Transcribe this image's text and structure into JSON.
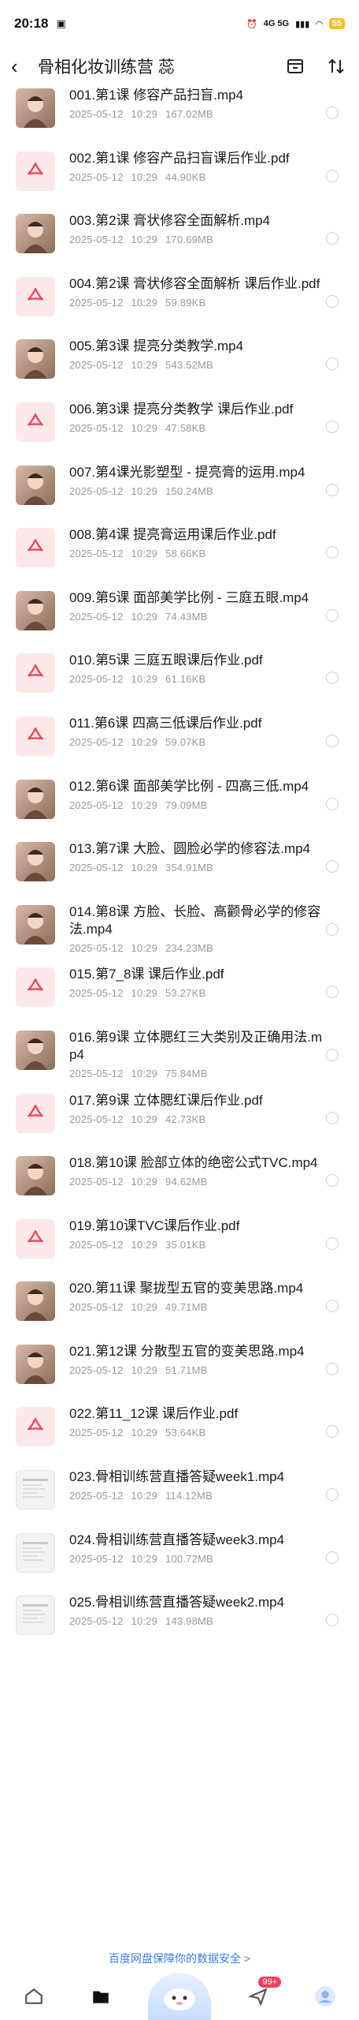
{
  "status": {
    "time": "20:18",
    "network": "4G 5G",
    "battery": "55"
  },
  "header": {
    "title": "骨相化妆训练营 蕊"
  },
  "files": [
    {
      "name": "001.第1课 修容产品扫盲.mp4",
      "date": "2025-05-12",
      "time": "10:29",
      "size": "167.02MB",
      "type": "video"
    },
    {
      "name": "002.第1课 修容产品扫盲课后作业.pdf",
      "date": "2025-05-12",
      "time": "10:29",
      "size": "44.90KB",
      "type": "pdf"
    },
    {
      "name": "003.第2课 膏状修容全面解析.mp4",
      "date": "2025-05-12",
      "time": "10:29",
      "size": "170.69MB",
      "type": "video"
    },
    {
      "name": "004.第2课 膏状修容全面解析 课后作业.pdf",
      "date": "2025-05-12",
      "time": "10:29",
      "size": "59.89KB",
      "type": "pdf"
    },
    {
      "name": "005.第3课 提亮分类教学.mp4",
      "date": "2025-05-12",
      "time": "10:29",
      "size": "543.52MB",
      "type": "video"
    },
    {
      "name": "006.第3课 提亮分类教学 课后作业.pdf",
      "date": "2025-05-12",
      "time": "10:29",
      "size": "47.58KB",
      "type": "pdf"
    },
    {
      "name": "007.第4课光影塑型 - 提亮膏的运用.mp4",
      "date": "2025-05-12",
      "time": "10:29",
      "size": "150.24MB",
      "type": "video"
    },
    {
      "name": "008.第4课 提亮膏运用课后作业.pdf",
      "date": "2025-05-12",
      "time": "10:29",
      "size": "58.66KB",
      "type": "pdf"
    },
    {
      "name": "009.第5课 面部美学比例 - 三庭五眼.mp4",
      "date": "2025-05-12",
      "time": "10:29",
      "size": "74.43MB",
      "type": "video"
    },
    {
      "name": "010.第5课 三庭五眼课后作业.pdf",
      "date": "2025-05-12",
      "time": "10:29",
      "size": "61.16KB",
      "type": "pdf"
    },
    {
      "name": "011.第6课 四高三低课后作业.pdf",
      "date": "2025-05-12",
      "time": "10:29",
      "size": "59.07KB",
      "type": "pdf"
    },
    {
      "name": "012.第6课 面部美学比例 - 四高三低.mp4",
      "date": "2025-05-12",
      "time": "10:29",
      "size": "79.09MB",
      "type": "video"
    },
    {
      "name": "013.第7课 大脸、圆脸必学的修容法.mp4",
      "date": "2025-05-12",
      "time": "10:29",
      "size": "354.91MB",
      "type": "video"
    },
    {
      "name": "014.第8课 方脸、长脸、高颧骨必学的修容法.mp4",
      "date": "2025-05-12",
      "time": "10:29",
      "size": "234.23MB",
      "type": "video"
    },
    {
      "name": "015.第7_8课 课后作业.pdf",
      "date": "2025-05-12",
      "time": "10:29",
      "size": "53.27KB",
      "type": "pdf"
    },
    {
      "name": "016.第9课 立体腮红三大类别及正确用法.mp4",
      "date": "2025-05-12",
      "time": "10:29",
      "size": "75.84MB",
      "type": "video"
    },
    {
      "name": "017.第9课 立体腮红课后作业.pdf",
      "date": "2025-05-12",
      "time": "10:29",
      "size": "42.73KB",
      "type": "pdf"
    },
    {
      "name": "018.第10课 脸部立体的绝密公式TVC.mp4",
      "date": "2025-05-12",
      "time": "10:29",
      "size": "94.62MB",
      "type": "video"
    },
    {
      "name": "019.第10课TVC课后作业.pdf",
      "date": "2025-05-12",
      "time": "10:29",
      "size": "35.01KB",
      "type": "pdf"
    },
    {
      "name": "020.第11课 聚拢型五官的变美思路.mp4",
      "date": "2025-05-12",
      "time": "10:29",
      "size": "49.71MB",
      "type": "video"
    },
    {
      "name": "021.第12课 分散型五官的变美思路.mp4",
      "date": "2025-05-12",
      "time": "10:29",
      "size": "51.71MB",
      "type": "video"
    },
    {
      "name": "022.第11_12课 课后作业.pdf",
      "date": "2025-05-12",
      "time": "10:29",
      "size": "53.64KB",
      "type": "pdf"
    },
    {
      "name": "023.骨相训练营直播答疑week1.mp4",
      "date": "2025-05-12",
      "time": "10:29",
      "size": "114.12MB",
      "type": "doc"
    },
    {
      "name": "024.骨相训练营直播答疑week3.mp4",
      "date": "2025-05-12",
      "time": "10:29",
      "size": "100.72MB",
      "type": "doc"
    },
    {
      "name": "025.骨相训练营直播答疑week2.mp4",
      "date": "2025-05-12",
      "time": "10:29",
      "size": "143.98MB",
      "type": "doc"
    }
  ],
  "footer": {
    "note": "百度网盘保障你的数据安全 >"
  },
  "nav": {
    "badge": "99+"
  },
  "colors": {
    "accent": "#3d7ff0",
    "pdf_red": "#f0475a",
    "badge": "#f2405a"
  }
}
